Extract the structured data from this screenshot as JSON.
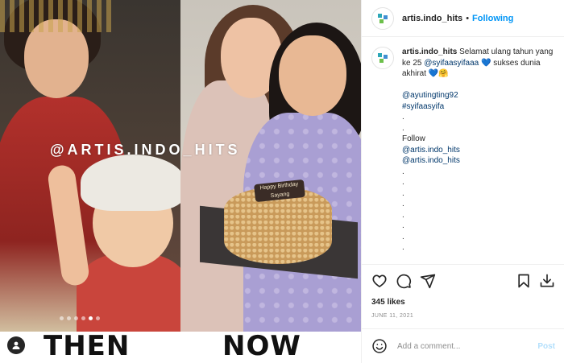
{
  "media": {
    "watermark": "@ARTIS.INDO_HITS",
    "then_label": "THEN",
    "now_label": "NOW",
    "cake_topper": "Happy Birthday Sayang"
  },
  "header": {
    "username": "artis.indo_hits",
    "separator": "•",
    "follow_status": "Following"
  },
  "caption": {
    "username": "artis.indo_hits",
    "text": "Selamat ulang tahun yang ke 25",
    "mention_1": "@syifaasyifaaa",
    "text_2": "sukses dunia akhirat",
    "emoji_1": "💙",
    "emoji_2": "💙🤗",
    "tag_1": "@ayutingting92",
    "hashtag_1": "#syifaasyifa",
    "dot": ".",
    "follow_word": "Follow",
    "follow_1": "@artis.indo_hits",
    "follow_2": "@artis.indo_hits"
  },
  "engagement": {
    "likes": "345 likes",
    "date": "JUNE 11, 2021"
  },
  "comment": {
    "placeholder": "Add a comment...",
    "post_label": "Post"
  },
  "colors": {
    "accent": "#0095f6",
    "post_disabled": "#b2dffc",
    "text": "#262626",
    "muted": "#8e8e8e"
  }
}
